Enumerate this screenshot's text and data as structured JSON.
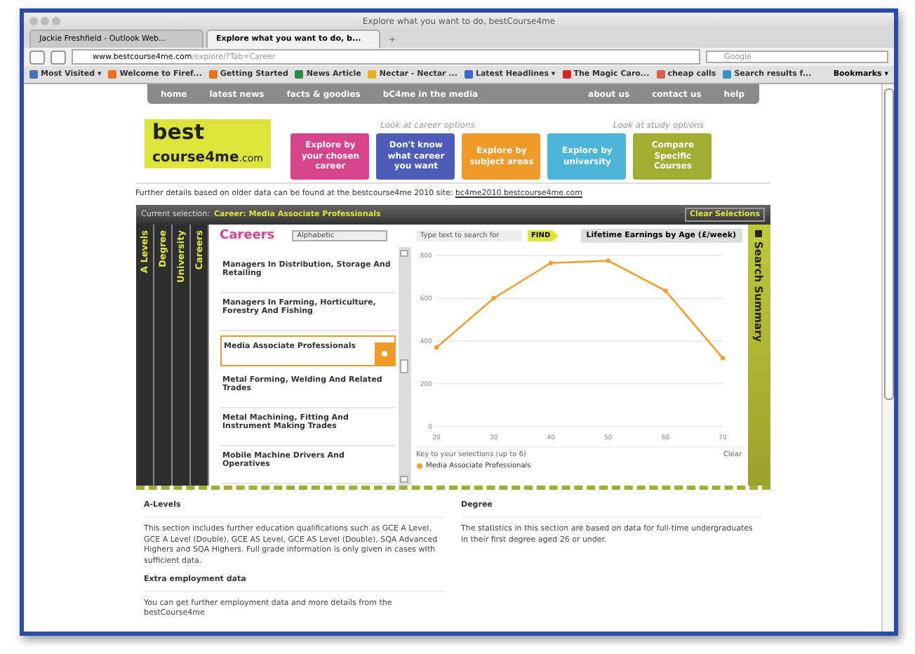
{
  "browser": {
    "window_title": "Explore what you want to do, bestCourse4me",
    "tabs": [
      {
        "label": "Jackie Freshfield - Outlook Web...",
        "selected": false
      },
      {
        "label": "Explore what you want to do, b...",
        "selected": true
      }
    ],
    "address": {
      "domain": "www.bestcourse4me.com",
      "path": "/explore/?Tab=Career"
    },
    "new_tab": "+",
    "search_placeholder": "Google",
    "bookmarks": [
      {
        "label": "Most Visited ▾",
        "color": "#4a6fb0"
      },
      {
        "label": "Welcome to Firef...",
        "color": "#e8721c"
      },
      {
        "label": "Getting Started",
        "color": "#e8721c"
      },
      {
        "label": "News Article",
        "color": "#2e8a3c"
      },
      {
        "label": "Nectar - Nectar ...",
        "color": "#e8b020"
      },
      {
        "label": "Latest Headlines ▾",
        "color": "#3a68c8"
      },
      {
        "label": "The Magic Caro...",
        "color": "#d02a20"
      },
      {
        "label": "cheap calls",
        "color": "#e06050"
      },
      {
        "label": "Search results f...",
        "color": "#3a90c0"
      }
    ],
    "bookmarks_menu": "Bookmarks ▾"
  },
  "site": {
    "nav_left": [
      "home",
      "latest news",
      "facts & goodies",
      "bC4me in the media"
    ],
    "nav_right": [
      "about us",
      "contact us",
      "help"
    ],
    "logo": {
      "line1": "best",
      "line2": "course4me",
      ".com": ".com"
    },
    "hint_career": "Look at career options",
    "hint_study": "Look at study options",
    "explore_buttons": [
      {
        "label": "Explore by your chosen career",
        "color": "#d8438c"
      },
      {
        "label": "Don't know what career you want",
        "color": "#4c5cb8"
      },
      {
        "label": "Explore by subject areas",
        "color": "#f09a2a"
      },
      {
        "label": "Explore by university",
        "color": "#4cb6d8"
      },
      {
        "label": "Compare Specific Courses",
        "color": "#a2ae32"
      }
    ],
    "older_data_note": {
      "text": "Further details based on older data can be found at the bestcourse4me 2010 site:",
      "link": "bc4me2010.bestcourse4me.com"
    },
    "selection": {
      "label": "Current selection:",
      "value": "Career: Media Associate Professionals",
      "clear": "Clear Selections"
    },
    "side_tabs": [
      {
        "label": "A Levels"
      },
      {
        "label": "Degree"
      },
      {
        "label": "University"
      },
      {
        "label": "Careers"
      }
    ],
    "careers": {
      "title": "Careers",
      "sort": "Alphabetic",
      "items": [
        {
          "label": "Managers In Distribution, Storage And Retailing",
          "selected": false
        },
        {
          "label": "Managers In Farming, Horticulture, Forestry And Fishing",
          "selected": false
        },
        {
          "label": "Media Associate Professionals",
          "selected": true
        },
        {
          "label": "Metal Forming, Welding And Related Trades",
          "selected": false
        },
        {
          "label": "Metal Machining, Fitting And Instrument Making Trades",
          "selected": false
        },
        {
          "label": "Mobile Machine Drivers And Operatives",
          "selected": false
        }
      ]
    },
    "search": {
      "placeholder": "Type text to search for",
      "button": "FIND"
    },
    "chart_title": "Lifetime Earnings by Age (£/week)",
    "chart_data": {
      "type": "line",
      "x": [
        20,
        30,
        40,
        50,
        60,
        70
      ],
      "series": [
        {
          "name": "Media Associate Professionals",
          "color": "#f0a030",
          "marker": "circle",
          "values": [
            370,
            600,
            765,
            775,
            635,
            320
          ]
        }
      ],
      "xticks": [
        20,
        30,
        40,
        50,
        60,
        70
      ],
      "yticks": [
        0,
        200,
        400,
        600,
        800
      ],
      "xlim": [
        20,
        70
      ],
      "ylim": [
        0,
        800
      ],
      "grid": true
    },
    "key": {
      "title": "Key to your selections (up to 6)",
      "clear": "Clear"
    },
    "summary_tab": "Search Summary",
    "sections": [
      {
        "heading": "A-Levels",
        "text": "This section includes further education qualifications such as GCE A Level, GCE A Level (Double), GCE AS Level, GCE AS Level (Double), SQA Advanced Highers and SQA Highers. Full grade information is only given in cases with sufficient data."
      },
      {
        "heading": "Degree",
        "text": "The statistics in this section are based on data for full-time undergraduates in their first degree aged 26 or under."
      },
      {
        "heading": "Extra employment data",
        "text": "You can get further employment data and more details from the bestCourse4me"
      }
    ]
  }
}
